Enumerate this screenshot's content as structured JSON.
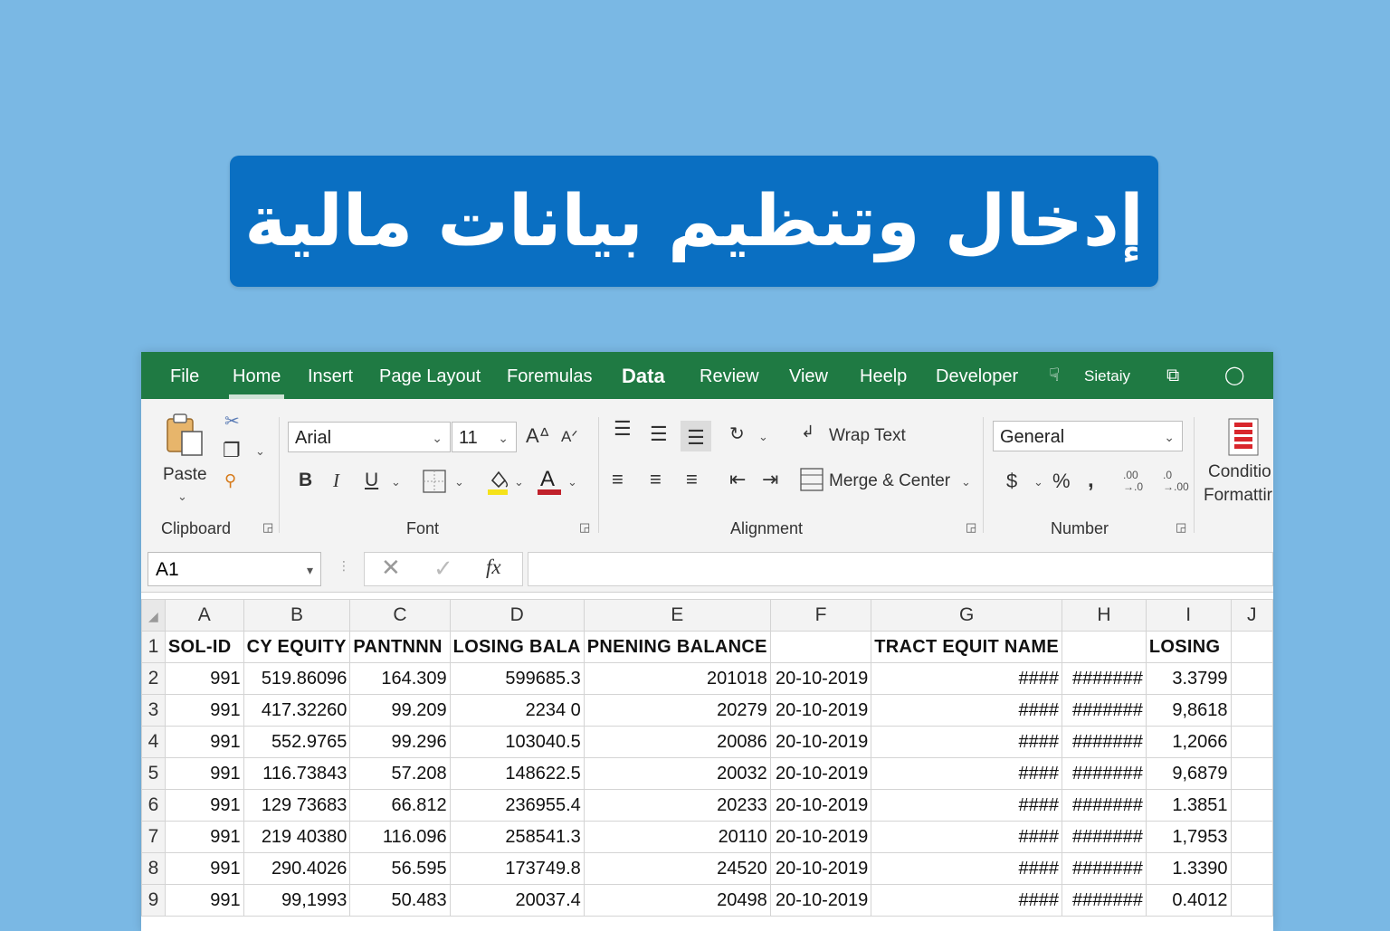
{
  "banner": {
    "title": "إدخال وتنظيم بيانات مالية"
  },
  "menu": {
    "items": [
      "File",
      "Home",
      "Insert",
      "Page Layout",
      "Foremulas",
      "Data",
      "Review",
      "View",
      "Heelp",
      "Developer"
    ],
    "extra_label": "Sietaiy"
  },
  "ribbon": {
    "clipboard": {
      "paste_label": "Paste",
      "group_label": "Clipboard"
    },
    "font": {
      "font_name": "Arial",
      "font_size": "11",
      "group_label": "Font",
      "fill_color": "#f5e21a",
      "font_color": "#c0212b"
    },
    "alignment": {
      "wrap_text": "Wrap Text",
      "merge_center": "Merge & Center",
      "group_label": "Alignment"
    },
    "number": {
      "format": "General",
      "group_label": "Number",
      "inc_decimal": ".00 →.0",
      "dec_decimal": ".0 →.00"
    },
    "conditional": {
      "line1": "Conditio",
      "line2": "Formattir"
    }
  },
  "formula_bar": {
    "name_box": "A1",
    "fx": "fx",
    "formula_value": ""
  },
  "grid": {
    "columns": [
      "A",
      "B",
      "C",
      "D",
      "E",
      "F",
      "G",
      "H",
      "I",
      "J"
    ],
    "header_row": [
      "SOL-ID",
      "CY EQUITY",
      "PANTNNN",
      "LOSING BALA",
      "PNENING BALANCE",
      "",
      "TRACT EQUIT NAME",
      "",
      "LOSING",
      ""
    ],
    "rows": [
      [
        "2",
        "991",
        "519.86096",
        "164.309",
        "599685.3",
        "201018",
        "20-10-2019",
        "####",
        "#######",
        "3.3799",
        ""
      ],
      [
        "3",
        "991",
        "417.32260",
        "99.209",
        "2234 0",
        "20279",
        "20-10-2019",
        "####",
        "#######",
        "9,8618",
        ""
      ],
      [
        "4",
        "991",
        "552.9765",
        "99.296",
        "103040.5",
        "20086",
        "20-10-2019",
        "####",
        "#######",
        "1,2066",
        ""
      ],
      [
        "5",
        "991",
        "116.73843",
        "57.208",
        "148622.5",
        "20032",
        "20-10-2019",
        "####",
        "#######",
        "9,6879",
        ""
      ],
      [
        "6",
        "991",
        "129 73683",
        "66.812",
        "236955.4",
        "20233",
        "20-10-2019",
        "####",
        "#######",
        "1.3851",
        ""
      ],
      [
        "7",
        "991",
        "219 40380",
        "116.096",
        "258541.3",
        "20110",
        "20-10-2019",
        "####",
        "#######",
        "1,7953",
        ""
      ],
      [
        "8",
        "991",
        "290.4026",
        "56.595",
        "173749.8",
        "24520",
        "20-10-2019",
        "####",
        "#######",
        "1.3390",
        ""
      ],
      [
        "9",
        "991",
        "99,1993",
        "50.483",
        "20037.4",
        "20498",
        "20-10-2019",
        "####",
        "#######",
        "0.4012",
        ""
      ]
    ]
  },
  "colors": {
    "menubar": "#1f7a43",
    "banner": "#0a6fc2",
    "background": "#7ab8e4"
  }
}
